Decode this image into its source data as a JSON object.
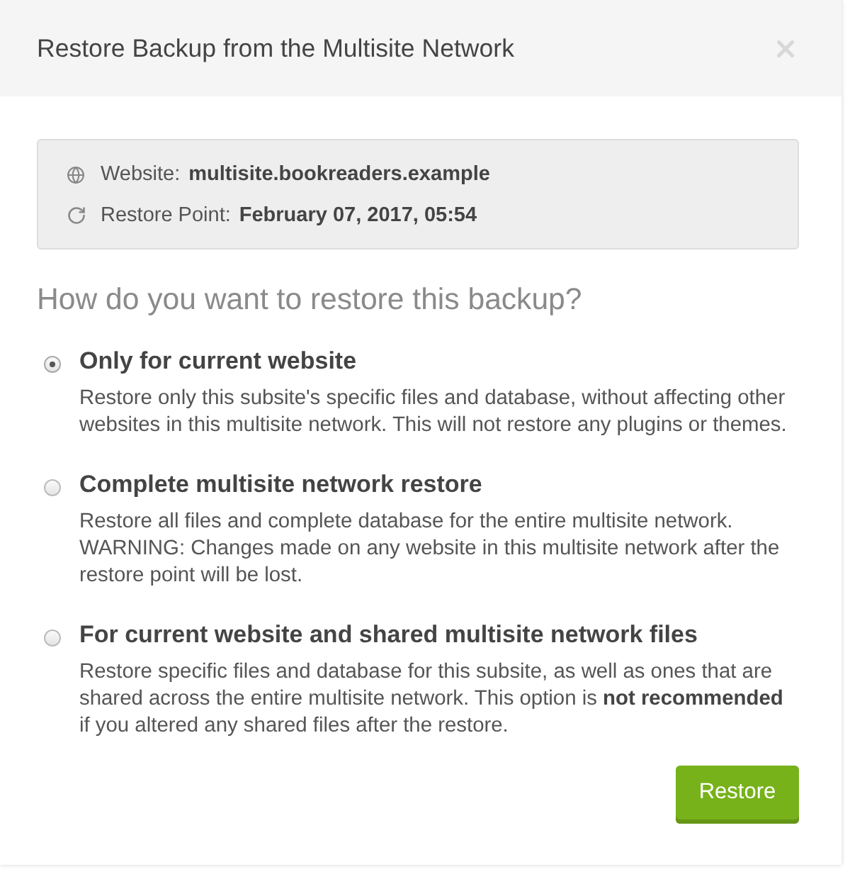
{
  "dialog": {
    "title": "Restore Backup from the Multisite Network"
  },
  "info": [
    {
      "kind": "website",
      "label": "Website:",
      "value": "multisite.bookreaders.example"
    },
    {
      "kind": "restore_point",
      "label": "Restore Point:",
      "value": "February 07, 2017, 05:54"
    }
  ],
  "question": "How do you want to restore this backup?",
  "options": [
    {
      "title": "Only for current website",
      "description": "Restore only this subsite's specific files and database, without affecting other websites in this multisite network. This will not restore any plugins or themes.",
      "selected": true
    },
    {
      "title": "Complete multisite network restore",
      "description": "Restore all files and complete database for the entire multisite network. WARNING: Changes made on any website in this multisite network after the restore point will be lost.",
      "selected": false
    },
    {
      "title": "For current website and shared multisite network files",
      "description": "Restore specific files and database for this subsite, as well as ones that are shared across the entire multisite network. This option is **not recommended** if you altered any shared files after the restore.",
      "selected": false
    }
  ],
  "buttons": [
    {
      "label": "Restore"
    }
  ]
}
